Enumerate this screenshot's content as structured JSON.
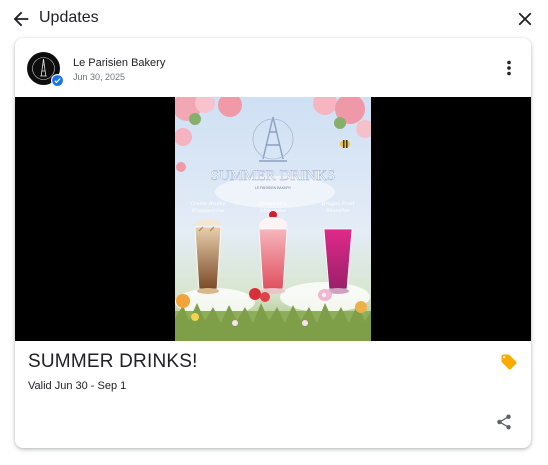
{
  "header": {
    "title": "Updates",
    "back_icon": "arrow-back-icon",
    "close_icon": "close-icon"
  },
  "post": {
    "business_name": "Le Parisien Bakery",
    "date": "Jun 30, 2025",
    "title": "SUMMER DRINKS!",
    "validity": "Valid Jun 30 - Sep 1",
    "offer_icon": "tag-icon",
    "offer_color": "#f9ab00",
    "verified_color": "#1a73e8",
    "image": {
      "headline": "SUMMER DRINKS",
      "items": [
        "Creme Brulee Frappuccino",
        "Strawberry Milkshake",
        "Dragon Fruit Smoothie"
      ]
    }
  }
}
